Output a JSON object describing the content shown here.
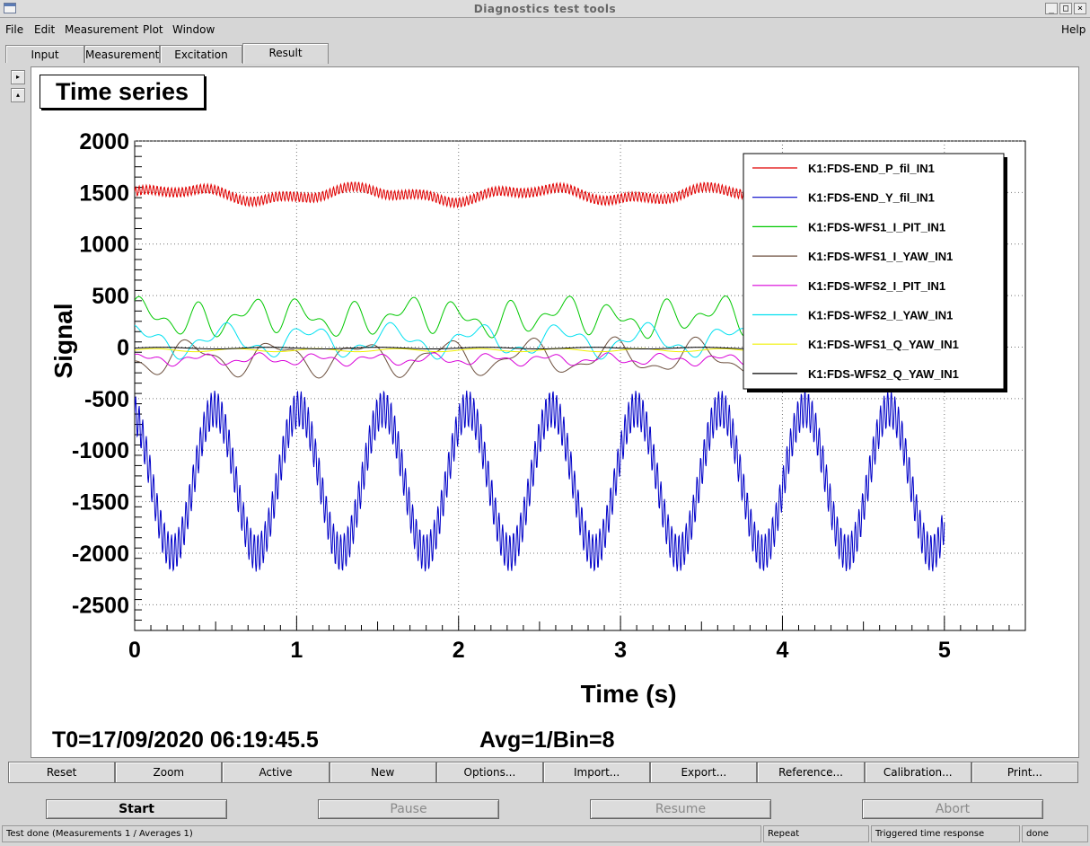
{
  "window": {
    "title": "Diagnostics test tools",
    "buttons": [
      "_",
      "□",
      "×"
    ]
  },
  "menu": {
    "items": [
      {
        "name": "file",
        "label": "File"
      },
      {
        "name": "edit",
        "label": "Edit"
      },
      {
        "name": "measurement",
        "label": "Measurement"
      },
      {
        "name": "plot",
        "label": "Plot"
      },
      {
        "name": "window",
        "label": "Window"
      }
    ],
    "help": "Help"
  },
  "tabs": [
    {
      "name": "input",
      "label": "Input",
      "active": false
    },
    {
      "name": "measurement",
      "label": "Measurement",
      "active": false
    },
    {
      "name": "excitation",
      "label": "Excitation",
      "active": false
    },
    {
      "name": "result",
      "label": "Result",
      "active": true
    }
  ],
  "side_arrows": [
    "▸",
    "▴"
  ],
  "plot": {
    "title": "Time series",
    "t0": "T0=17/09/2020 06:19:45.5",
    "avg": "Avg=1/Bin=8"
  },
  "chart_data": {
    "type": "line",
    "title": "Time series",
    "xlabel": "Time (s)",
    "ylabel": "Signal",
    "xlim": [
      0,
      5.5
    ],
    "ylim": [
      -2750,
      2000
    ],
    "xticks": [
      0,
      1,
      2,
      3,
      4,
      5
    ],
    "yticks": [
      2000,
      1500,
      1000,
      500,
      0,
      -500,
      -1000,
      -1500,
      -2000,
      -2500
    ],
    "grid": true,
    "legend_position": "top-right",
    "series": [
      {
        "name": "K1:FDS-END_P_fil_IN1",
        "color": "#e00000",
        "model": {
          "offset": 1480,
          "slow": [
            [
              50,
              0.9,
              0.0
            ],
            [
              30,
              2.3,
              1.0
            ]
          ],
          "fast": [
            [
              45,
              45,
              0.0
            ]
          ]
        }
      },
      {
        "name": "K1:FDS-END_Y_fil_IN1",
        "color": "#0000c8",
        "model": {
          "offset": -1300,
          "slow": [
            [
              700,
              1.92,
              1.9
            ]
          ],
          "fast": [
            [
              180,
              45,
              0.0
            ]
          ]
        }
      },
      {
        "name": "K1:FDS-WFS1_I_PIT_IN1",
        "color": "#00c800",
        "model": {
          "offset": 290,
          "slow": [
            [
              110,
              3.1,
              0.3
            ],
            [
              90,
              5.2,
              1.2
            ],
            [
              50,
              1.1,
              2.0
            ]
          ],
          "fast": []
        }
      },
      {
        "name": "K1:FDS-WFS1_I_YAW_IN1",
        "color": "#6b4e3c",
        "model": {
          "offset": -100,
          "slow": [
            [
              140,
              1.92,
              3.6
            ],
            [
              60,
              4.1,
              0.5
            ]
          ],
          "fast": []
        }
      },
      {
        "name": "K1:FDS-WFS2_I_PIT_IN1",
        "color": "#d800d8",
        "model": {
          "offset": -120,
          "slow": [
            [
              40,
              2.8,
              0.6
            ],
            [
              25,
              6.5,
              1.5
            ]
          ],
          "fast": []
        }
      },
      {
        "name": "K1:FDS-WFS2_I_YAW_IN1",
        "color": "#00e0f0",
        "model": {
          "offset": 60,
          "slow": [
            [
              120,
              1.92,
              1.2
            ],
            [
              60,
              5.0,
              2.4
            ]
          ],
          "fast": []
        }
      },
      {
        "name": "K1:FDS-WFS1_Q_YAW_IN1",
        "color": "#f0f000",
        "model": {
          "offset": -30,
          "slow": [
            [
              15,
              2.0,
              0.0
            ]
          ],
          "fast": []
        }
      },
      {
        "name": "K1:FDS-WFS2_Q_YAW_IN1",
        "color": "#000000",
        "model": {
          "offset": -10,
          "slow": [
            [
              8,
              1.5,
              0.0
            ]
          ],
          "fast": []
        }
      }
    ]
  },
  "toolbar": [
    "Reset",
    "Zoom",
    "Active",
    "New",
    "Options...",
    "Import...",
    "Export...",
    "Reference...",
    "Calibration...",
    "Print..."
  ],
  "controls": {
    "start": "Start",
    "pause": "Pause",
    "resume": "Resume",
    "abort": "Abort"
  },
  "status": {
    "message": "Test done (Measurements 1 / Averages 1)",
    "mode": "Repeat",
    "type": "Triggered time response",
    "state": "done"
  }
}
